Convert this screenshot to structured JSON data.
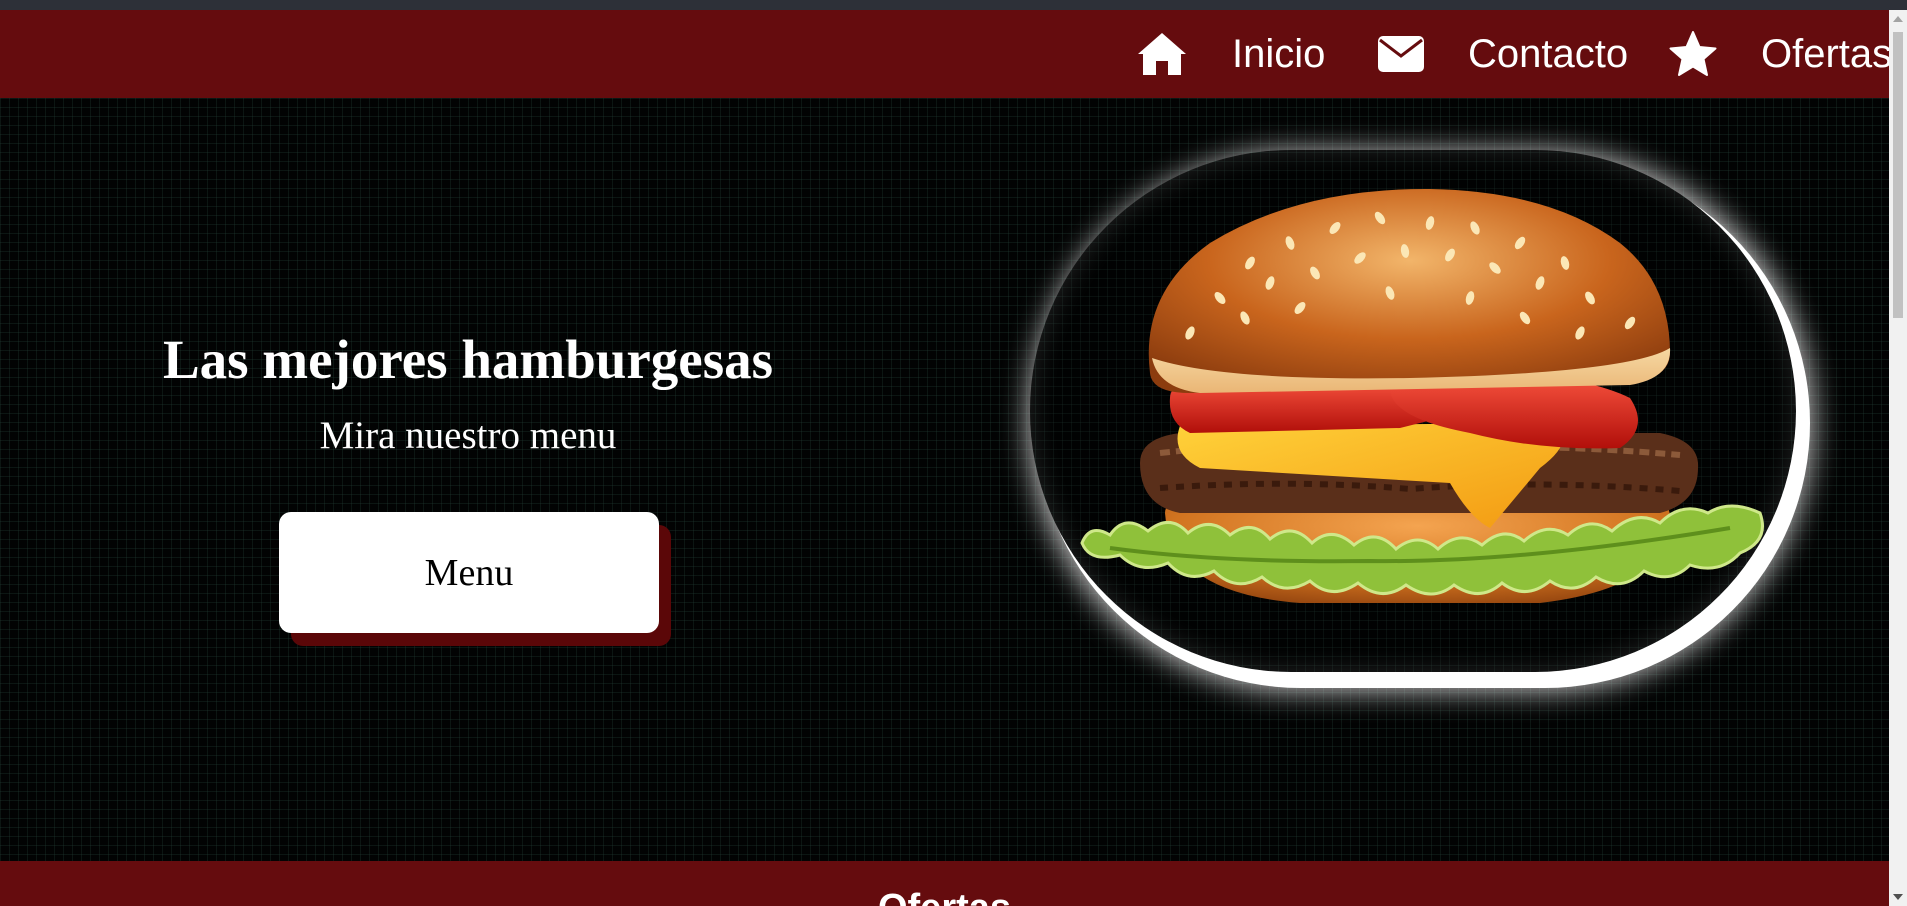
{
  "nav": {
    "items": [
      {
        "label": "Inicio",
        "icon": "home-icon"
      },
      {
        "label": "Contacto",
        "icon": "envelope-icon"
      },
      {
        "label": "Ofertas",
        "icon": "star-icon"
      }
    ]
  },
  "hero": {
    "title": "Las mejores hamburgesas",
    "subtitle": "Mira nuestro menu",
    "button_label": "Menu",
    "image": "hamburger-image"
  },
  "footer": {
    "title": "Ofertas"
  },
  "colors": {
    "brand": "#650c0e",
    "background": "#020303",
    "text": "#ffffff"
  }
}
